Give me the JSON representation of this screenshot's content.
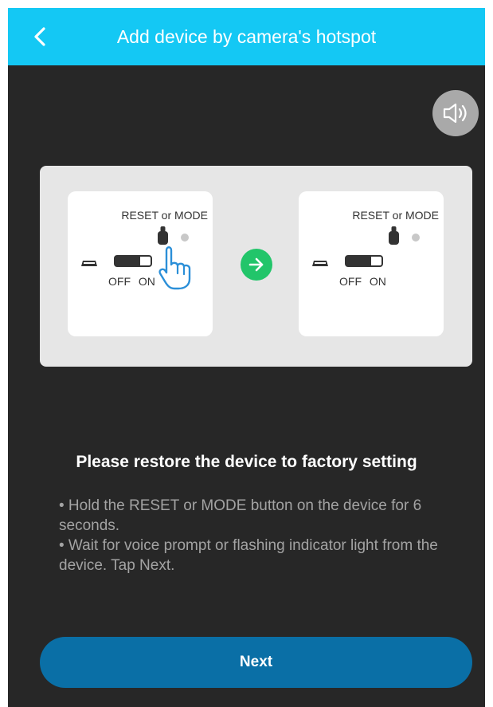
{
  "header": {
    "title": "Add device by camera's hotspot",
    "back_icon": "chevron-left-icon"
  },
  "speaker": {
    "icon": "speaker-icon"
  },
  "illustration": {
    "before": {
      "reset_label": "RESET or MODE",
      "switch_labels": "OFF ON"
    },
    "after": {
      "reset_label": "RESET or MODE",
      "switch_labels": "OFF ON"
    },
    "arrow_icon": "arrow-right-icon"
  },
  "main": {
    "heading": "Please restore the device to factory setting",
    "instructions": [
      "• Hold the RESET or MODE button on the device for 6 seconds.",
      "• Wait for voice prompt or flashing indicator light from the device. Tap Next."
    ]
  },
  "footer": {
    "next_label": "Next"
  },
  "colors": {
    "header_bg": "#14c8f4",
    "screen_bg": "#272727",
    "button_bg": "#0a6fa6",
    "arrow_bg": "#22c56a"
  }
}
